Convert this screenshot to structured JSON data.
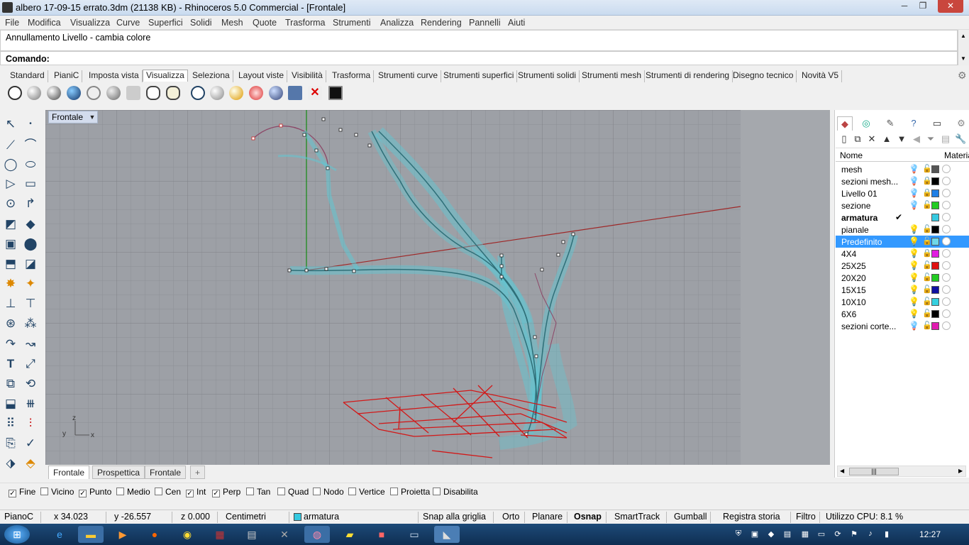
{
  "window": {
    "title": "albero 17-09-15 errato.3dm (21138 KB) - Rhinoceros 5.0 Commercial - [Frontale]",
    "min": "─",
    "max": "❐",
    "close": "✕"
  },
  "menu": [
    "File",
    "Modifica",
    "Visualizza",
    "Curve",
    "Superfici",
    "Solidi",
    "Mesh",
    "Quote",
    "Trasforma",
    "Strumenti",
    "Analizza",
    "Rendering",
    "Pannelli",
    "Aiuti"
  ],
  "command": {
    "history": "Annullamento Livello - cambia colore",
    "prompt": "Comando:"
  },
  "toolbar_tabs": [
    "Standard",
    "PianiC",
    "Imposta vista",
    "Visualizza",
    "Seleziona",
    "Layout viste",
    "Visibilità",
    "Trasforma",
    "Strumenti curve",
    "Strumenti superfici",
    "Strumenti solidi",
    "Strumenti mesh",
    "Strumenti di rendering",
    "Disegno tecnico",
    "Novità V5"
  ],
  "active_tab": "Visualizza",
  "viewport": {
    "label": "Frontale",
    "axis_z": "z",
    "axis_y": "y",
    "axis_x": "x"
  },
  "view_tabs": [
    "Frontale",
    "Prospettica",
    "Frontale"
  ],
  "view_tab_add": "+",
  "osnaps": [
    {
      "label": "Fine",
      "checked": true
    },
    {
      "label": "Vicino",
      "checked": false
    },
    {
      "label": "Punto",
      "checked": true
    },
    {
      "label": "Medio",
      "checked": false
    },
    {
      "label": "Cen",
      "checked": false
    },
    {
      "label": "Int",
      "checked": true
    },
    {
      "label": "Perp",
      "checked": true
    },
    {
      "label": "Tan",
      "checked": false
    },
    {
      "label": "Quad",
      "checked": false
    },
    {
      "label": "Nodo",
      "checked": false
    },
    {
      "label": "Vertice",
      "checked": false
    },
    {
      "label": "Proietta",
      "checked": false
    },
    {
      "label": "Disabilita",
      "checked": false
    }
  ],
  "status": {
    "cplane": "PianoC",
    "x": "x 34.023",
    "y": "y -26.557",
    "z": "z 0.000",
    "units": "Centimetri",
    "layer": "armatura",
    "layer_color": "#35c9e0",
    "snap_grid": "Snap alla griglia",
    "ortho": "Orto",
    "planar": "Planare",
    "osnap": "Osnap",
    "smarttrack": "SmartTrack",
    "gumball": "Gumball",
    "history": "Registra storia",
    "filter": "Filtro",
    "cpu": "Utilizzo CPU: 8.1 %"
  },
  "layers_panel": {
    "col_name": "Nome",
    "col_material": "Materia",
    "layers": [
      {
        "name": "mesh",
        "color": "#555555",
        "bulb": "on-blue",
        "lock": "unlocked"
      },
      {
        "name": "sezioni mesh...",
        "color": "#000000",
        "bulb": "on-blue",
        "lock": "locked"
      },
      {
        "name": "Livello 01",
        "color": "#1e7fe6",
        "bulb": "on-blue",
        "lock": "locked"
      },
      {
        "name": "sezione",
        "color": "#22cc22",
        "bulb": "on-blue",
        "lock": "unlocked"
      },
      {
        "name": "armatura",
        "color": "#35c9e0",
        "bulb": "current",
        "lock": "current"
      },
      {
        "name": "pianale",
        "color": "#000000",
        "bulb": "on-yellow",
        "lock": "unlocked"
      },
      {
        "name": "Predefinito",
        "color": "#6fd8e8",
        "bulb": "on-yellow",
        "lock": "unlocked"
      },
      {
        "name": "4X4",
        "color": "#e11ce1",
        "bulb": "on-yellow",
        "lock": "locked"
      },
      {
        "name": "25X25",
        "color": "#e01010",
        "bulb": "on-yellow",
        "lock": "unlocked"
      },
      {
        "name": "20X20",
        "color": "#22cc22",
        "bulb": "on-yellow",
        "lock": "unlocked"
      },
      {
        "name": "15X15",
        "color": "#1010a0",
        "bulb": "on-yellow",
        "lock": "unlocked"
      },
      {
        "name": "10X10",
        "color": "#35d0e0",
        "bulb": "on-yellow",
        "lock": "unlocked"
      },
      {
        "name": "6X6",
        "color": "#000000",
        "bulb": "on-yellow",
        "lock": "unlocked"
      },
      {
        "name": "sezioni corte...",
        "color": "#e11cb0",
        "bulb": "on-blue",
        "lock": "unlocked"
      }
    ],
    "current_mark": "✔",
    "selected": "Predefinito",
    "scroll_thumb": "|||"
  },
  "taskbar": {
    "start": "⊞",
    "clock": "12:27"
  }
}
